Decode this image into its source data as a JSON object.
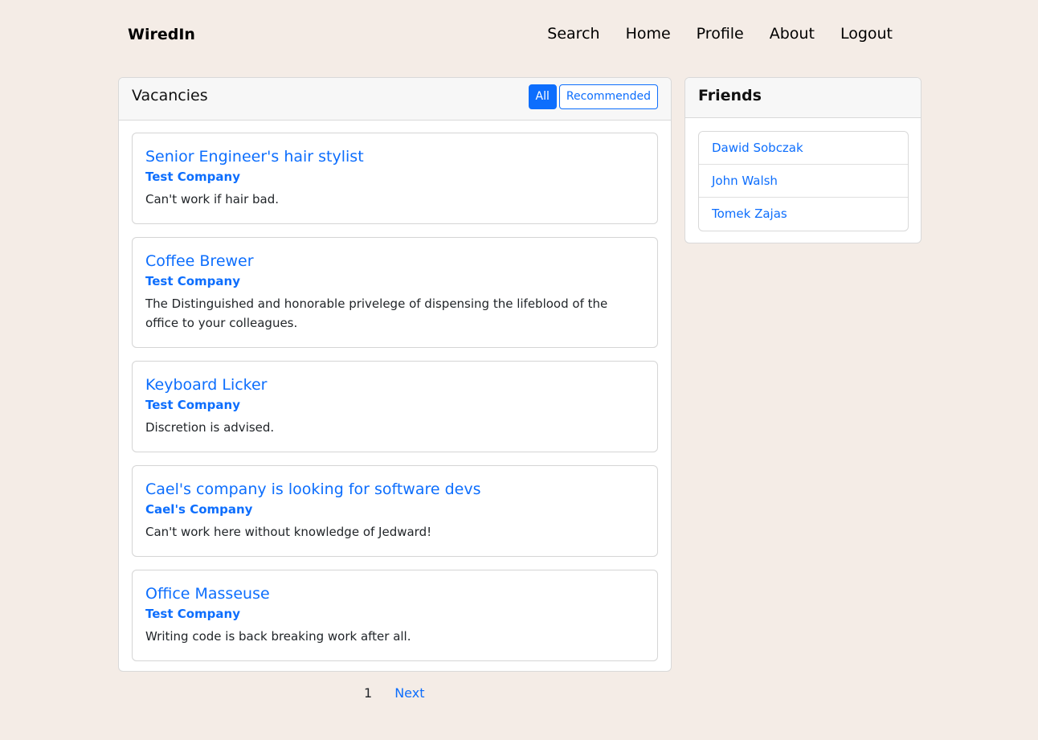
{
  "navbar": {
    "brand": "WiredIn",
    "links": [
      "Search",
      "Home",
      "Profile",
      "About",
      "Logout"
    ]
  },
  "vacancies": {
    "title": "Vacancies",
    "filters": {
      "all": "All",
      "recommended": "Recommended",
      "active": "All"
    },
    "items": [
      {
        "title": "Senior Engineer's hair stylist",
        "company": "Test Company",
        "description": "Can't work if hair bad."
      },
      {
        "title": "Coffee Brewer",
        "company": "Test Company",
        "description": "The Distinguished and honorable privelege of dispensing the lifeblood of the office to your colleagues."
      },
      {
        "title": "Keyboard Licker",
        "company": "Test Company",
        "description": "Discretion is advised."
      },
      {
        "title": "Cael's company is looking for software devs",
        "company": "Cael's Company",
        "description": "Can't work here without knowledge of Jedward!"
      },
      {
        "title": "Office Masseuse",
        "company": "Test Company",
        "description": "Writing code is back breaking work after all."
      }
    ]
  },
  "pagination": {
    "current": "1",
    "next": "Next"
  },
  "friends": {
    "title": "Friends",
    "items": [
      "Dawid Sobczak",
      "John Walsh",
      "Tomek Zajas"
    ]
  },
  "colors": {
    "background": "#f4ece6",
    "accent": "#0d6efd"
  }
}
